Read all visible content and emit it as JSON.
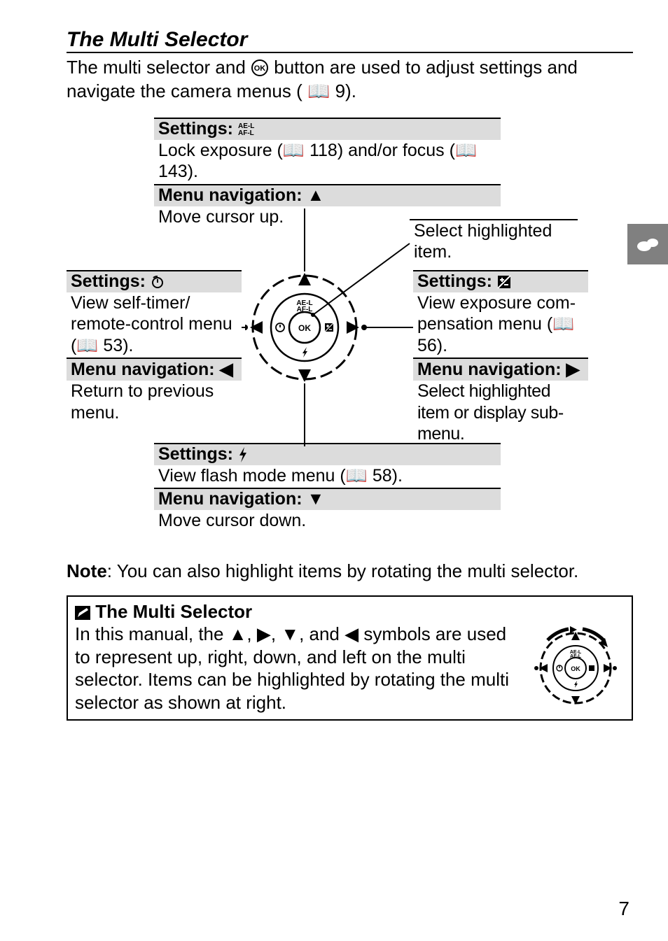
{
  "title": "The Multi Selector",
  "intro_pre": "The multi selector and ",
  "intro_post": " button are used to adjust settings and navigate the camera menus (",
  "intro_page": " 9).",
  "groups": {
    "up": {
      "settings_label": "Settings: ",
      "settings_body_a": "Lock exposure (",
      "settings_body_page1": " 118) and/or focus (",
      "settings_body_page2": " 143).",
      "nav_label": "Menu navigation: ",
      "nav_body": "Move cursor up."
    },
    "ok": {
      "body": "Select highlighted item."
    },
    "left": {
      "settings_label": "Settings: ",
      "settings_body_a": "View self-timer/ remote-control menu (",
      "settings_body_page": " 53).",
      "nav_label": "Menu navigation: ",
      "nav_body": "Return to previous menu."
    },
    "right": {
      "settings_label": "Settings: ",
      "settings_body_a": "View exposure com­pensation menu (",
      "settings_body_page": " 56).",
      "nav_label": "Menu navigation: ",
      "nav_body": "Select highlighted item or display sub-menu."
    },
    "down": {
      "settings_label": "Settings: ",
      "settings_body_a": "View flash mode menu (",
      "settings_body_page": " 58).",
      "nav_label": "Menu navigation: ",
      "nav_body": "Move cursor down."
    }
  },
  "note_label": "Note",
  "note_body": ": You can also highlight items by rotating the multi selector.",
  "callout": {
    "title": " The Multi Selector",
    "body_a": "In this manual, the ",
    "body_b": ", ",
    "body_c": ", ",
    "body_d": ", and ",
    "body_e": " symbols are used to represent up, right, down, and left on the multi selector. Items can be highlighted by rotating the multi selector as shown at right."
  },
  "page_number": "7",
  "icons": {
    "ok_circle": "OK",
    "ae_l": "AE-L",
    "af_l": "AF-L"
  }
}
